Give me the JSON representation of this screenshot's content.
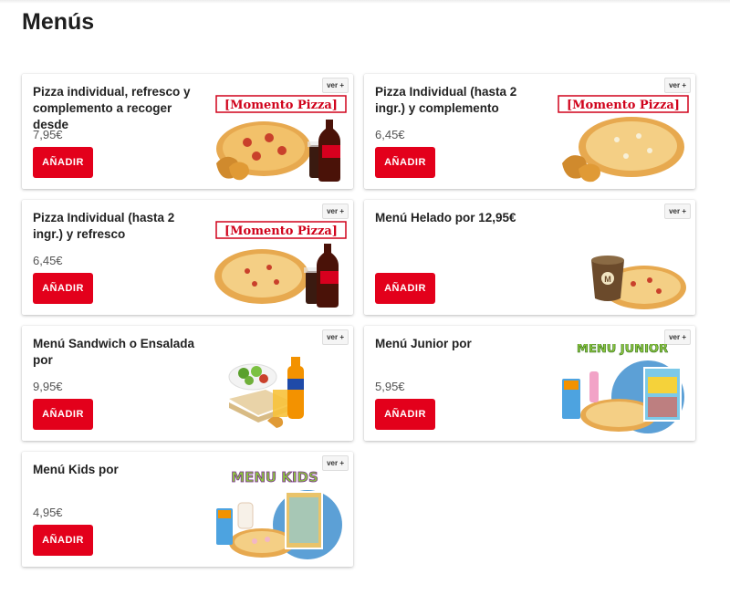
{
  "page": {
    "title": "Menús"
  },
  "cards": [
    {
      "title": "Pizza individual, refresco y complemento a recoger desde",
      "price": "7,95€",
      "button": "AÑADIR",
      "more": "ver +",
      "art_text": "[Momento Pizza]",
      "image": "pizza-drink-wedges"
    },
    {
      "title": "Pizza Individual (hasta 2 ingr.) y complemento",
      "price": "6,45€",
      "button": "AÑADIR",
      "more": "ver +",
      "art_text": "[Momento Pizza]",
      "image": "pizza-wedges"
    },
    {
      "title": "Pizza Individual (hasta 2 ingr.) y refresco",
      "price": "6,45€",
      "button": "AÑADIR",
      "more": "ver +",
      "art_text": "[Momento Pizza]",
      "image": "pizza-drink"
    },
    {
      "title": "Menú Helado por 12,95€",
      "price": "",
      "button": "AÑADIR",
      "more": "ver +",
      "art_text": "",
      "image": "icecream-pizza"
    },
    {
      "title": "Menú Sandwich o Ensalada por",
      "price": "9,95€",
      "button": "AÑADIR",
      "more": "ver +",
      "art_text": "",
      "image": "salad-sandwich-drink"
    },
    {
      "title": "Menú Junior por",
      "price": "5,95€",
      "button": "AÑADIR",
      "more": "ver +",
      "art_text": "MENÚ JUNIOR",
      "image": "junior"
    },
    {
      "title": "Menú Kids por",
      "price": "4,95€",
      "button": "AÑADIR",
      "more": "ver +",
      "art_text": "MENU KIDS",
      "image": "kids"
    }
  ],
  "colors": {
    "accent": "#e3001b",
    "logo_red": "#d0021b"
  }
}
